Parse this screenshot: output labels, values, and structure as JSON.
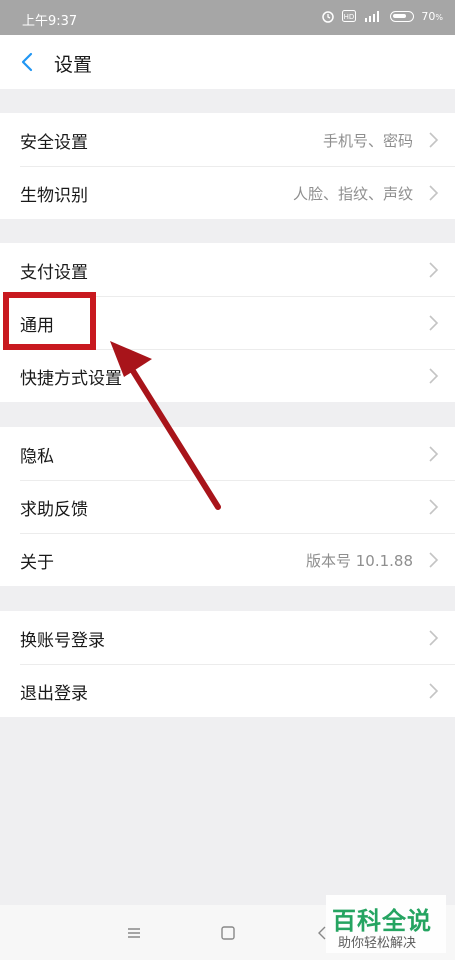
{
  "status": {
    "time": "上午9:37",
    "battery": "70",
    "battery_unit": "%"
  },
  "header": {
    "title": "设置"
  },
  "groups": [
    {
      "items": [
        {
          "label": "安全设置",
          "value": "手机号、密码"
        },
        {
          "label": "生物识别",
          "value": "人脸、指纹、声纹"
        }
      ]
    },
    {
      "items": [
        {
          "label": "支付设置",
          "value": ""
        },
        {
          "label": "通用",
          "value": ""
        },
        {
          "label": "快捷方式设置",
          "value": ""
        }
      ]
    },
    {
      "items": [
        {
          "label": "隐私",
          "value": ""
        },
        {
          "label": "求助反馈",
          "value": ""
        },
        {
          "label": "关于",
          "value": "版本号 10.1.88"
        }
      ]
    },
    {
      "items": [
        {
          "label": "换账号登录",
          "value": ""
        },
        {
          "label": "退出登录",
          "value": ""
        }
      ]
    }
  ],
  "watermark": {
    "main": "百科全说",
    "sub": "助你轻松解决"
  },
  "colors": {
    "highlight": "#c8191f",
    "accent": "#2196f3"
  }
}
